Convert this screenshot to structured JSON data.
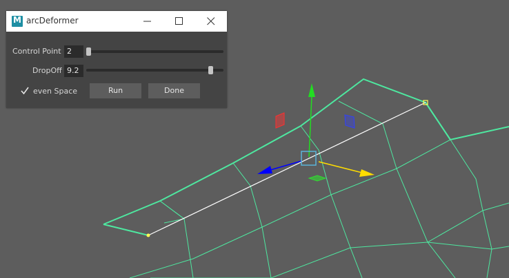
{
  "window": {
    "title": "arcDeformer",
    "icon": "maya-m-icon",
    "icon_letter": "M"
  },
  "controls": {
    "control_point": {
      "label": "Control Point",
      "value": "2",
      "slider_fraction": 0.0
    },
    "dropoff": {
      "label": "DropOff",
      "value": "9.2",
      "slider_fraction": 0.92
    },
    "even_space": {
      "label": "even Space",
      "checked": true
    },
    "run_label": "Run",
    "done_label": "Done"
  },
  "colors": {
    "viewport_bg": "#5d5d5d",
    "wireframe": "#4ee8a0",
    "curve": "#ffffff",
    "axis_y": "#22dd22",
    "axis_x": "#ffdd00",
    "axis_z": "#0000ff",
    "plane_red": "#ff3030",
    "plane_blue": "#3040ff",
    "plane_green": "#30dd30",
    "manipulator_center": "#5bb4d9"
  }
}
